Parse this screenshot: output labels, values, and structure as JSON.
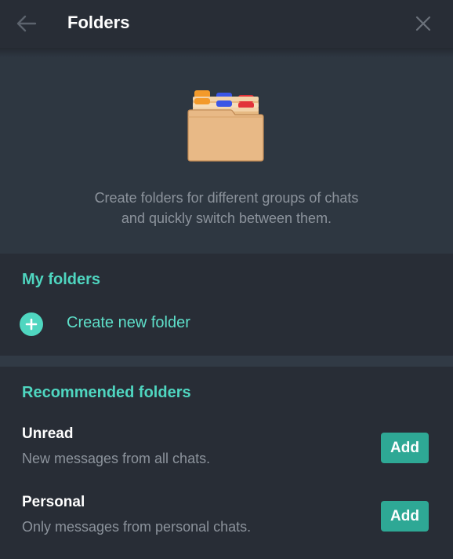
{
  "header": {
    "title": "Folders",
    "back_icon": "arrow-left-icon",
    "close_icon": "close-icon"
  },
  "intro": {
    "illustration": "folders-illustration",
    "text_line1": "Create folders for different groups of chats",
    "text_line2": "and quickly switch between them."
  },
  "my_folders": {
    "title": "My folders",
    "create_label": "Create new folder",
    "create_icon": "plus-circle-icon"
  },
  "recommended": {
    "title": "Recommended folders",
    "items": [
      {
        "name": "Unread",
        "description": "New messages from all chats.",
        "button": "Add"
      },
      {
        "name": "Personal",
        "description": "Only messages from personal chats.",
        "button": "Add"
      }
    ]
  },
  "colors": {
    "background": "#282d36",
    "intro_background": "#2e3741",
    "accent": "#4fd6c0",
    "button": "#2ea895",
    "muted_text": "#8c939c"
  }
}
